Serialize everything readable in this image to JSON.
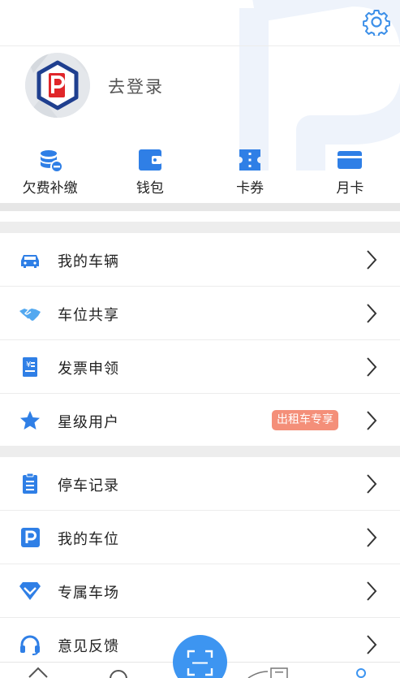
{
  "header": {
    "settings_icon": "gear-icon"
  },
  "profile": {
    "login_text": "去登录",
    "avatar_icon": "parking-logo-icon"
  },
  "quick_actions": [
    {
      "label": "欠费补缴",
      "icon": "coins-icon"
    },
    {
      "label": "钱包",
      "icon": "wallet-icon"
    },
    {
      "label": "卡券",
      "icon": "ticket-icon"
    },
    {
      "label": "月卡",
      "icon": "card-icon"
    }
  ],
  "menu_group_1": [
    {
      "label": "我的车辆",
      "icon": "car-icon"
    },
    {
      "label": "车位共享",
      "icon": "handshake-icon"
    },
    {
      "label": "发票申领",
      "icon": "invoice-icon"
    },
    {
      "label": "星级用户",
      "icon": "star-icon",
      "badge": "出租车专享"
    }
  ],
  "menu_group_2": [
    {
      "label": "停车记录",
      "icon": "clipboard-icon"
    },
    {
      "label": "我的车位",
      "icon": "parking-icon"
    },
    {
      "label": "专属车场",
      "icon": "diamond-icon"
    },
    {
      "label": "意见反馈",
      "icon": "headset-icon"
    }
  ],
  "tabbar": {
    "scan_icon": "scan-icon"
  },
  "colors": {
    "accent": "#2f7fe6",
    "badge": "#f48f79",
    "separator": "#ededed"
  }
}
